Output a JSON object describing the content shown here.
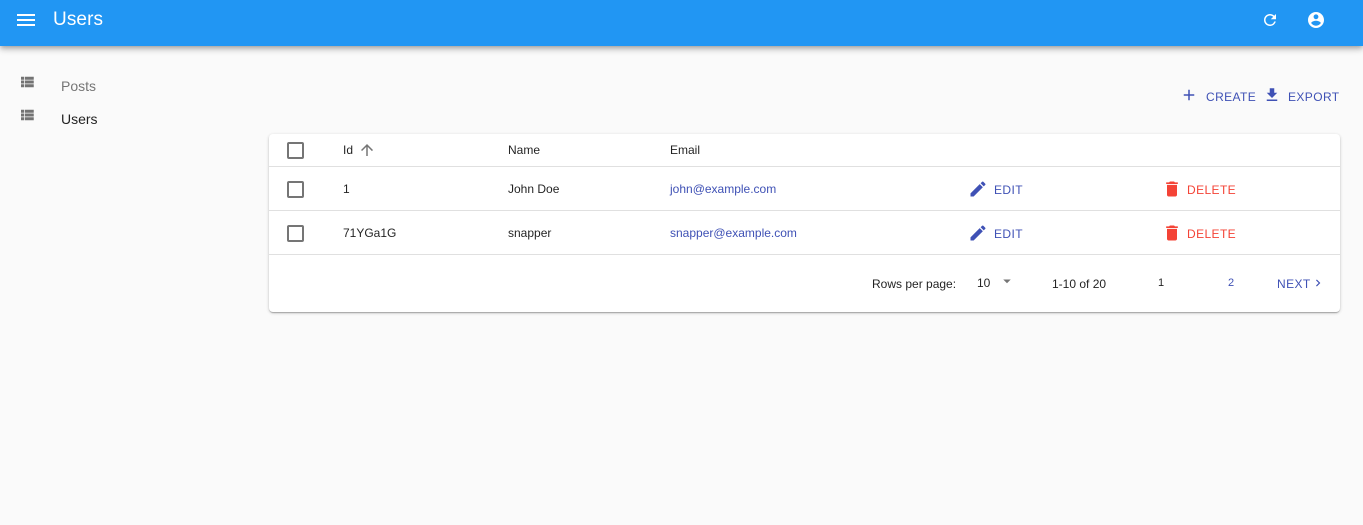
{
  "app_bar": {
    "title": "Users",
    "icons": {
      "menu": "menu-icon",
      "refresh": "refresh-icon",
      "account": "account-circle-icon"
    },
    "color": "#2196f3"
  },
  "sidebar": {
    "items": [
      {
        "label": "Posts",
        "icon": "list-icon",
        "active": false
      },
      {
        "label": "Users",
        "icon": "list-icon",
        "active": true
      }
    ]
  },
  "actions": {
    "create_label": "CREATE",
    "export_label": "EXPORT",
    "icons": {
      "create": "add-icon",
      "export": "download-icon"
    }
  },
  "table": {
    "headers": {
      "id": "Id",
      "name": "Name",
      "email": "Email"
    },
    "sort": {
      "column": "Id",
      "direction": "ascending"
    },
    "rows": [
      {
        "id": "1",
        "name": "John Doe",
        "email": "john@example.com",
        "edit_label": "EDIT",
        "delete_label": "DELETE"
      },
      {
        "id": "71YGa1G",
        "name": "snapper",
        "email": "snapper@example.com",
        "edit_label": "EDIT",
        "delete_label": "DELETE"
      }
    ]
  },
  "pagination": {
    "rows_per_page_label": "Rows per page:",
    "rows_per_page": "10",
    "range": "1-10 of 20",
    "pages": [
      "1",
      "2"
    ],
    "current_page": "1",
    "next_label": "NEXT"
  },
  "colors": {
    "primary": "#3f51b5",
    "danger": "#f44336",
    "app_bar": "#2196f3",
    "background": "#fafafa"
  }
}
